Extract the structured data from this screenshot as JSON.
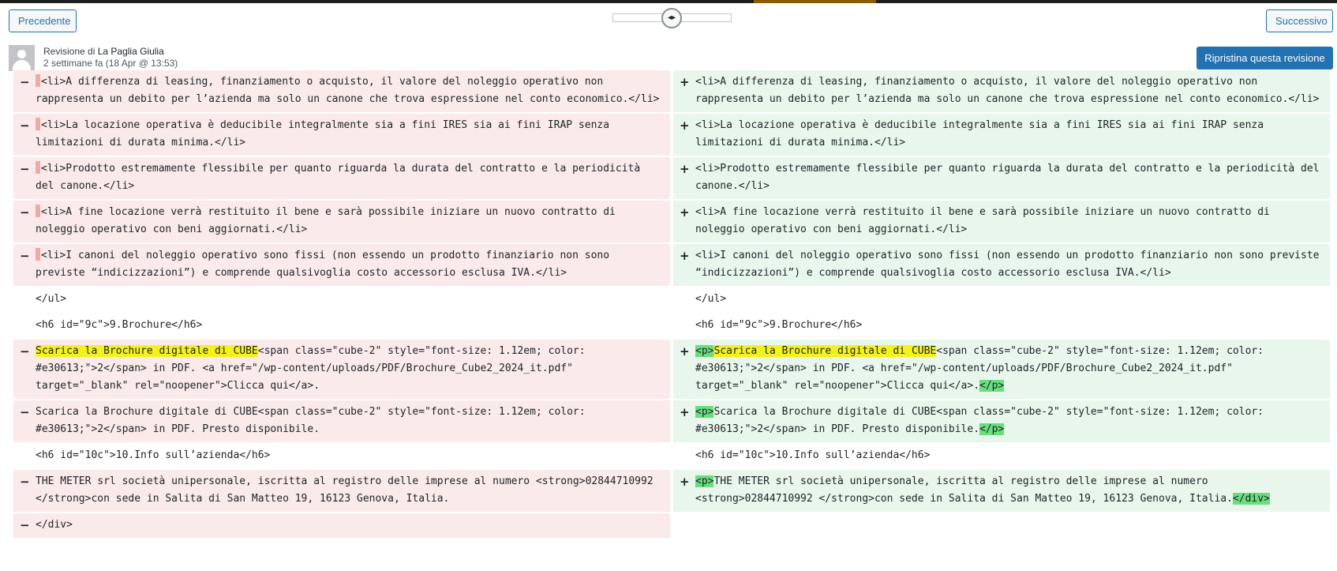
{
  "nav": {
    "prev_label": "Precedente",
    "next_label": "Successivo",
    "slider_handle_glyph": "◂▸"
  },
  "author": {
    "revision_prefix": "Revisione di ",
    "name": "La Paglia Giulia",
    "time_ago": "2 settimane fa",
    "date": "(18 Apr @ 13:53)"
  },
  "restore_label": "Ripristina questa revisione",
  "colors": {
    "removed_bg": "#fbeaea",
    "added_bg": "#e9f6ec",
    "removed_mark": "#f1a8a8",
    "added_mark": "#68de7c",
    "highlight": "#f5f21a",
    "accent": "#2271b1"
  },
  "diff": {
    "rows": [
      {
        "left": "<li>A differenza di leasing, finanziamento o acquisto, il valore del noleggio operativo non rappresenta un debito per l’azienda ma solo un canone che trova espressione nel conto economico.</li>",
        "right": "<li>A differenza di leasing, finanziamento o acquisto, il valore del noleggio operativo non rappresenta un debito per l’azienda ma solo un canone che trova espressione nel conto economico.</li>"
      },
      {
        "left": "<li>La locazione operativa è deducibile integralmente sia a fini IRES sia ai fini IRAP senza limitazioni di durata minima.</li>",
        "right": "<li>La locazione operativa è deducibile integralmente sia a fini IRES sia ai fini IRAP senza limitazioni di durata minima.</li>"
      },
      {
        "left": "<li>Prodotto estremamente flessibile per quanto riguarda la durata del contratto e la periodicità del canone.</li>",
        "right": "<li>Prodotto estremamente flessibile per quanto riguarda la durata del contratto e la periodicità del canone.</li>"
      },
      {
        "left": "<li>A fine locazione verrà restituito il bene e sarà possibile iniziare un nuovo contratto di noleggio operativo con beni aggiornati.</li>",
        "right": "<li>A fine locazione verrà restituito il bene e sarà possibile iniziare un nuovo contratto di noleggio operativo con beni aggiornati.</li>"
      },
      {
        "left": "<li>I canoni del noleggio operativo sono fissi (non essendo un prodotto finanziario non sono previste “indicizzazioni”) e comprende qualsivoglia costo accessorio esclusa IVA.</li>",
        "right": "<li>I canoni del noleggio operativo sono fissi (non essendo un prodotto finanziario non sono previste “indicizzazioni”) e comprende qualsivoglia costo accessorio esclusa IVA.</li>"
      },
      {
        "context": "</ul>"
      },
      {
        "context": "<h6 id=\"9c\">9.Brochure</h6>"
      },
      {
        "left_highlight": "Scarica la Brochure digitale di CUBE",
        "left_rest": "<span class=\"cube-2\" style=\"font-size: 1.12em; color: #e30613;\">2</span> in PDF. <a href=\"/wp-content/uploads/PDF/Brochure_Cube2_2024_it.pdf\" target=\"_blank\" rel=\"noopener\">Clicca qui</a>.",
        "right_open_tag": "<p>",
        "right_highlight": "Scarica la Brochure digitale di CUBE",
        "right_rest": "<span class=\"cube-2\" style=\"font-size: 1.12em; color: #e30613;\">2</span> in PDF. <a href=\"/wp-content/uploads/PDF/Brochure_Cube2_2024_it.pdf\" target=\"_blank\" rel=\"noopener\">Clicca qui</a>.",
        "right_close_tag": "</p>"
      },
      {
        "left": "Scarica la Brochure digitale di CUBE<span class=\"cube-2\" style=\"font-size: 1.12em; color: #e30613;\">2</span> in PDF. Presto disponibile.",
        "right_open_tag": "<p>",
        "right": "Scarica la Brochure digitale di CUBE<span class=\"cube-2\" style=\"font-size: 1.12em; color: #e30613;\">2</span> in PDF. Presto disponibile.",
        "right_close_tag": "</p>"
      },
      {
        "context": "<h6 id=\"10c\">10.Info sull’azienda</h6>"
      },
      {
        "left": "THE METER srl società unipersonale, iscritta al registro delle imprese al numero <strong>02844710992 </strong>con sede in Salita di San Matteo 19, 16123 Genova, Italia.",
        "right_open_tag": "<p>",
        "right": "THE METER srl società unipersonale, iscritta al registro delle imprese al numero <strong>02844710992 </strong>con sede in Salita di San Matteo 19, 16123 Genova, Italia.",
        "right_close_tag": "</div>"
      },
      {
        "left": "</div>"
      }
    ],
    "minus": "−",
    "plus": "+"
  }
}
